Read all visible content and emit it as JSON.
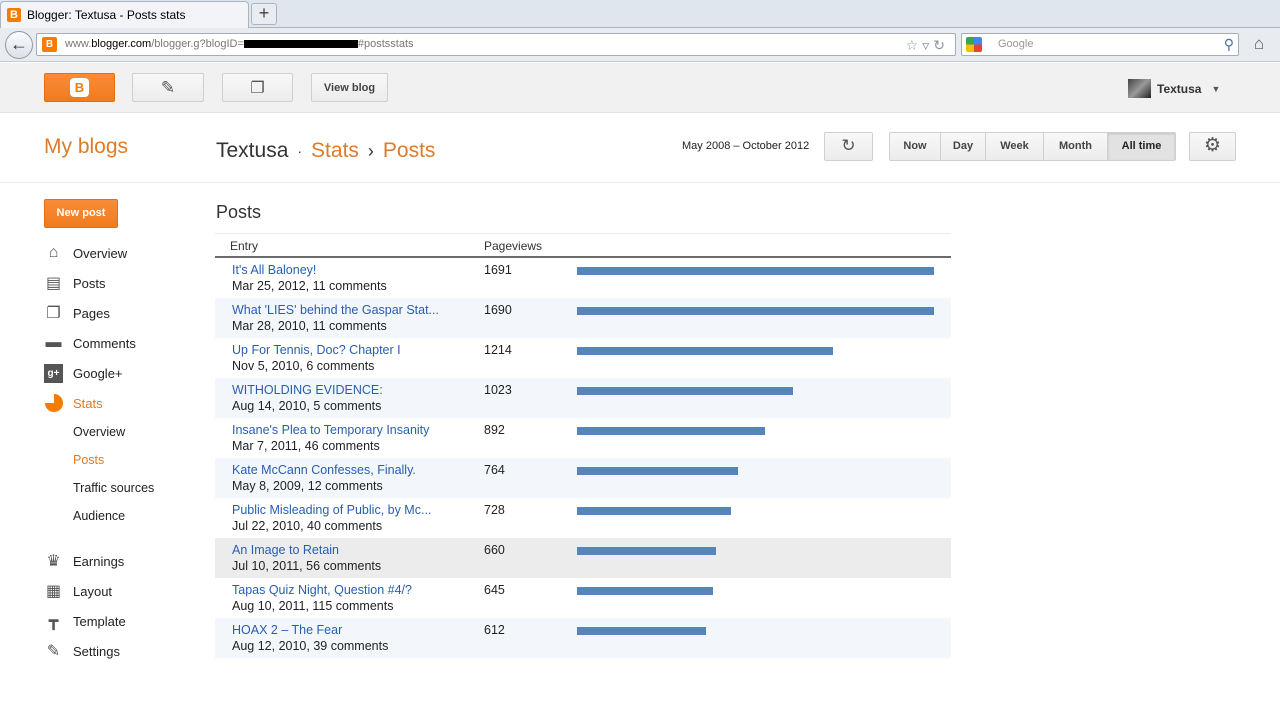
{
  "browser": {
    "tab_title": "Blogger: Textusa - Posts stats",
    "url_prefix": "www.",
    "url_domain": "blogger.com",
    "url_path": "/blogger.g?blogID=",
    "url_suffix": "#postsstats",
    "search_placeholder": "Google"
  },
  "toolbar": {
    "view_blog_label": "View blog",
    "user_name": "Textusa"
  },
  "header": {
    "my_blogs": "My blogs",
    "blog_name": "Textusa",
    "crumb_sep_dot": "·",
    "crumb_stats": "Stats",
    "crumb_sep_arrow": "›",
    "crumb_posts": "Posts",
    "date_range": "May 2008 – October 2012",
    "periods": [
      "Now",
      "Day",
      "Week",
      "Month",
      "All time"
    ],
    "active_period": "All time"
  },
  "sidebar": {
    "new_post_label": "New post",
    "items": [
      {
        "label": "Overview",
        "icon": "home-icon"
      },
      {
        "label": "Posts",
        "icon": "posts-icon"
      },
      {
        "label": "Pages",
        "icon": "pages-icon"
      },
      {
        "label": "Comments",
        "icon": "comment-icon"
      },
      {
        "label": "Google+",
        "icon": "google-plus-icon"
      },
      {
        "label": "Stats",
        "icon": "pie-chart-icon"
      }
    ],
    "stats_subitems": [
      "Overview",
      "Posts",
      "Traffic sources",
      "Audience"
    ],
    "lower_items": [
      {
        "label": "Earnings",
        "icon": "trophy-icon"
      },
      {
        "label": "Layout",
        "icon": "layout-icon"
      },
      {
        "label": "Template",
        "icon": "paint-roller-icon"
      },
      {
        "label": "Settings",
        "icon": "wrench-icon"
      }
    ]
  },
  "main": {
    "title": "Posts",
    "columns": [
      "Entry",
      "Pageviews"
    ],
    "max_pageviews": 1691,
    "rows": [
      {
        "title": "It's All Baloney!",
        "meta": "Mar 25, 2012, 11 comments",
        "pageviews": 1691
      },
      {
        "title": "What 'LIES' behind the Gaspar Stat...",
        "meta": "Mar 28, 2010, 11 comments",
        "pageviews": 1690
      },
      {
        "title": "Up For Tennis, Doc? Chapter I",
        "meta": "Nov 5, 2010, 6 comments",
        "pageviews": 1214
      },
      {
        "title": "WITHOLDING EVIDENCE:",
        "meta": "Aug 14, 2010, 5 comments",
        "pageviews": 1023
      },
      {
        "title": "Insane's Plea to Temporary Insanity",
        "meta": "Mar 7, 2011, 46 comments",
        "pageviews": 892
      },
      {
        "title": "Kate McCann Confesses, Finally.",
        "meta": "May 8, 2009, 12 comments",
        "pageviews": 764
      },
      {
        "title": "Public Misleading of Public, by Mc...",
        "meta": "Jul 22, 2010, 40 comments",
        "pageviews": 728
      },
      {
        "title": "An Image to Retain",
        "meta": "Jul 10, 2011, 56 comments",
        "pageviews": 660
      },
      {
        "title": "Tapas Quiz Night, Question #4/?",
        "meta": "Aug 10, 2011, 115 comments",
        "pageviews": 645
      },
      {
        "title": "HOAX 2 – The Fear",
        "meta": "Aug 12, 2010, 39 comments",
        "pageviews": 612
      }
    ]
  },
  "colors": {
    "brand_orange": "#f57c00",
    "link_blue": "#2a5db0",
    "bar_blue": "#5486bd"
  }
}
